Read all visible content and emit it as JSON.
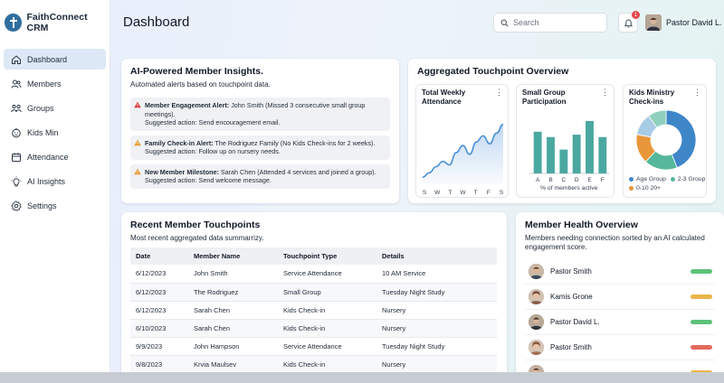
{
  "brand": {
    "name": "FaithConnect CRM"
  },
  "sidebar": {
    "items": [
      {
        "label": "Dashboard",
        "icon": "home-icon",
        "active": true
      },
      {
        "label": "Members",
        "icon": "users-icon"
      },
      {
        "label": "Groups",
        "icon": "groups-icon"
      },
      {
        "label": "Kids Min",
        "icon": "kids-icon"
      },
      {
        "label": "Attendance",
        "icon": "calendar-icon"
      },
      {
        "label": "AI Insights",
        "icon": "lightbulb-icon"
      },
      {
        "label": "Settings",
        "icon": "gear-icon"
      }
    ]
  },
  "header": {
    "title": "Dashboard",
    "search_placeholder": "Search",
    "notification_count": "1",
    "user_name": "Pastor David L."
  },
  "insights": {
    "title": "AI-Powered Member Insights.",
    "subtitle": "Automated alerts based on touchpoint data.",
    "alerts": [
      {
        "heading": "Member Engagement Alert:",
        "text": " John Smith (Missed 3 consecutive small group meetings).",
        "action": "Suggested action: Send encouragement email.",
        "color": "#d9363e"
      },
      {
        "heading": "Family Check-in Alert:",
        "text": " The Rodriguez Family (No Kids Check-ins for 2 weeks).",
        "action": "Suggested action: Follow up on nursery needs.",
        "color": "#e8962a"
      },
      {
        "heading": "New Member Milestone:",
        "text": " Sarah Chen (Attended 4 services and joined a group).",
        "action": "Suggested action: Send welcome message.",
        "color": "#e8962a"
      }
    ]
  },
  "overview": {
    "title": "Aggregated Touchpoint Overview",
    "panels": [
      {
        "title_line1": "Total Weekly",
        "title_line2": "Attendance"
      },
      {
        "title_line1": "Small Group",
        "title_line2": "Participation",
        "footer": "% of members active"
      },
      {
        "title_line1": "Kids Ministry",
        "title_line2": "Check-ins"
      }
    ],
    "kebab": "⋮"
  },
  "chart_data": [
    {
      "type": "area",
      "title": "Total Weekly Attendance",
      "categories": [
        "S",
        "W",
        "T",
        "W",
        "T",
        "F",
        "S"
      ],
      "x": [
        0,
        1,
        2,
        3,
        4,
        5,
        6,
        7,
        8,
        9,
        10,
        11,
        12
      ],
      "values": [
        8,
        13,
        20,
        26,
        22,
        36,
        44,
        34,
        48,
        55,
        46,
        58,
        68
      ],
      "ylim": [
        0,
        80
      ],
      "color": "#4a90d9"
    },
    {
      "type": "bar",
      "title": "Small Group Participation",
      "categories": [
        "A",
        "B",
        "C",
        "D",
        "E",
        "F"
      ],
      "values": [
        70,
        61,
        40,
        65,
        88,
        61
      ],
      "ylim": [
        0,
        100
      ],
      "xlabel": "% of members active",
      "color": "#4aa8a0"
    },
    {
      "type": "pie",
      "title": "Kids Ministry Check-ins",
      "donut": true,
      "slices": [
        {
          "label": "Age Group",
          "value": 44,
          "color": "#3f86c8"
        },
        {
          "label": "2-3 Group",
          "value": 18,
          "color": "#55b79c"
        },
        {
          "label": "0-10 20+",
          "value": 16,
          "color": "#e8963a"
        },
        {
          "label": "",
          "value": 12,
          "color": "#a8cbe6"
        },
        {
          "label": "",
          "value": 10,
          "color": "#8fd0bc"
        }
      ],
      "legend": "bottom"
    }
  ],
  "recent": {
    "title": "Recent Member Touchpoints",
    "subtitle": "Most recent aggregated data summarrizy.",
    "columns": [
      "Date",
      "Member Name",
      "Touchpoint Type",
      "Details"
    ],
    "rows": [
      [
        "6/12/2023",
        "John Smith",
        "Service Attendance",
        "10 AM Service"
      ],
      [
        "6/12/2023",
        "The Rodriguez",
        "Small Group",
        "Tuesday Night Study"
      ],
      [
        "6/12/2023",
        "Sarah Chen",
        "Kids Check-in",
        "Nursery"
      ],
      [
        "6/10/2023",
        "Sarah Chen",
        "Kids Check-in",
        "Nursery"
      ],
      [
        "9/9/2023",
        "John Hampson",
        "Service Attendance",
        "Tuesday Night Study"
      ],
      [
        "9/8/2023",
        "Krvia Maulsev",
        "Kids Check-in",
        "Nursery"
      ]
    ]
  },
  "health": {
    "title": "Member Health Overview",
    "subtitle": "Members needing connection sorted by an AI calculated engagement score.",
    "members": [
      {
        "name": "Pastor Smith",
        "status_color": "#5cc27a"
      },
      {
        "name": "Kamis Grone",
        "status_color": "#e9b54a"
      },
      {
        "name": "Pastor David L.",
        "status_color": "#5cc27a"
      },
      {
        "name": "Pastor Smith",
        "status_color": "#e36a5e"
      },
      {
        "name": "",
        "status_color": "#e9b54a"
      }
    ]
  }
}
